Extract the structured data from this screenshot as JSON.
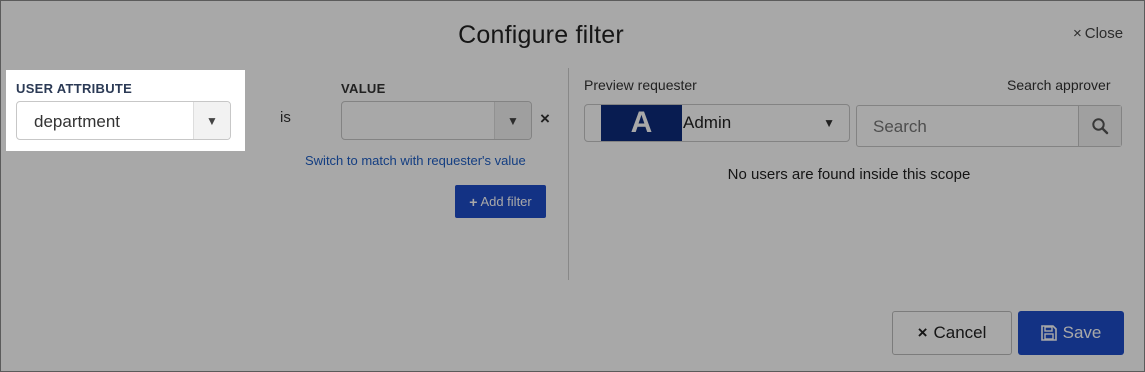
{
  "dialog": {
    "title": "Configure filter",
    "close_label": "Close",
    "close_icon": "×"
  },
  "filter": {
    "attribute_label": "USER ATTRIBUTE",
    "attribute_value": "department",
    "operator": "is",
    "value_label": "VALUE",
    "value_value": "",
    "remove_icon": "×",
    "switch_link": "Switch to match with requester's value",
    "add_filter_label": "Add filter",
    "add_icon": "+"
  },
  "preview": {
    "requester_label": "Preview requester",
    "search_approver_label": "Search approver",
    "requester_avatar": "A",
    "requester_name": "Admin",
    "search_placeholder": "Search",
    "empty_message": "No users are found inside this scope"
  },
  "footer": {
    "cancel_label": "Cancel",
    "cancel_icon": "×",
    "save_label": "Save"
  },
  "colors": {
    "primary": "#1d4cc9",
    "avatar_bg": "#0d2b7b",
    "link": "#1f5fc5",
    "overlay": "rgba(0,0,0,0.34)"
  }
}
